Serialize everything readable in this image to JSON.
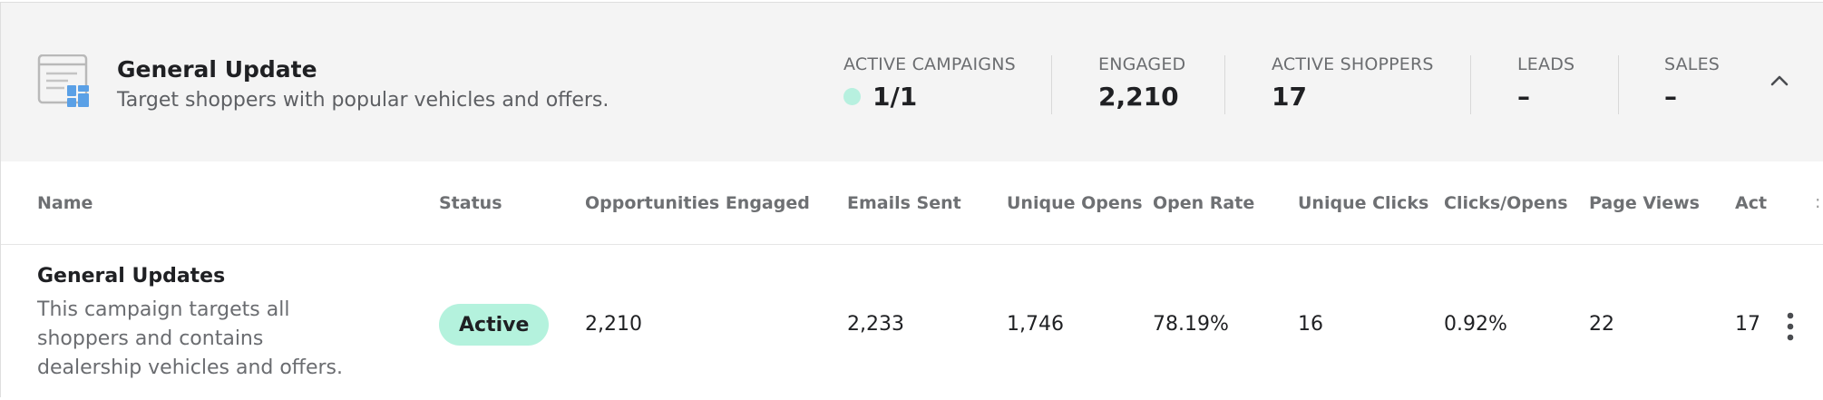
{
  "header": {
    "title": "General Update",
    "subtitle": "Target shoppers with popular vehicles and offers.",
    "icon": "campaign-layout-icon",
    "stats": [
      {
        "label": "ACTIVE CAMPAIGNS",
        "value": "1/1",
        "indicator_color": "#b7f0df"
      },
      {
        "label": "ENGAGED",
        "value": "2,210"
      },
      {
        "label": "ACTIVE SHOPPERS",
        "value": "17"
      },
      {
        "label": "LEADS",
        "value": "–"
      },
      {
        "label": "SALES",
        "value": "–"
      }
    ],
    "collapse_icon": "chevron-up-icon"
  },
  "table": {
    "columns": [
      "Name",
      "Status",
      "Opportunities Engaged",
      "Emails Sent",
      "Unique Opens",
      "Open Rate",
      "Unique Clicks",
      "Clicks/Opens",
      "Page Views",
      "Act"
    ],
    "overflow_glyph": ":",
    "rows": [
      {
        "name": "General Updates",
        "description": "This campaign targets all shoppers and contains dealership vehicles and offers.",
        "status": "Active",
        "opportunities_engaged": "2,210",
        "emails_sent": "2,233",
        "unique_opens": "1,746",
        "open_rate": "78.19%",
        "unique_clicks": "16",
        "clicks_opens": "0.92%",
        "page_views": "22",
        "act": "17",
        "menu_icon": "kebab-menu-icon"
      }
    ]
  },
  "colors": {
    "header_bg": "#f4f4f4",
    "active_badge": "#b4f2dd",
    "icon_blue": "#5aa0e6"
  }
}
